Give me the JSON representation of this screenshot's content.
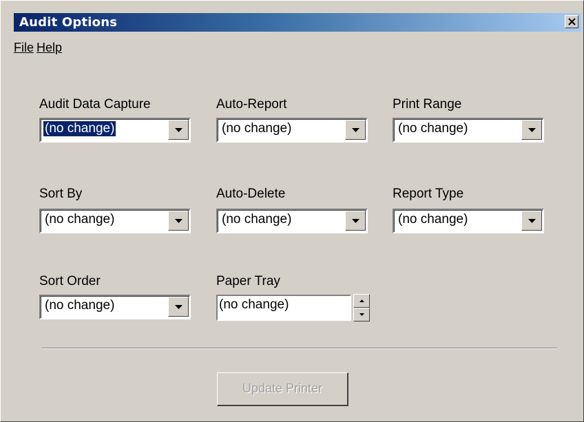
{
  "window": {
    "title": "Audit Options",
    "close_glyph": "✕"
  },
  "menu": {
    "items": [
      {
        "label": "File"
      },
      {
        "label": "Help"
      }
    ]
  },
  "fields": {
    "audit_data_capture": {
      "label": "Audit Data Capture",
      "value": "(no change)",
      "selected": true
    },
    "auto_report": {
      "label": "Auto-Report",
      "value": "(no change)"
    },
    "print_range": {
      "label": "Print Range",
      "value": "(no change)"
    },
    "sort_by": {
      "label": "Sort By",
      "value": "(no change)"
    },
    "auto_delete": {
      "label": "Auto-Delete",
      "value": "(no change)"
    },
    "report_type": {
      "label": "Report Type",
      "value": "(no change)"
    },
    "sort_order": {
      "label": "Sort Order",
      "value": "(no change)"
    },
    "paper_tray": {
      "label": "Paper Tray",
      "value": "(no change)"
    }
  },
  "buttons": {
    "update_printer": {
      "label": "Update Printer",
      "enabled": false
    }
  },
  "icons": {
    "dropdown": "chevron-down-icon",
    "close": "close-icon",
    "spin_up": "spin-up-icon",
    "spin_down": "spin-down-icon"
  }
}
